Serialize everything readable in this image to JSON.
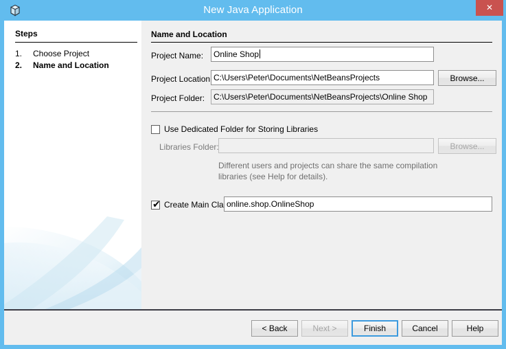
{
  "window": {
    "title": "New Java Application",
    "app_icon": "cube-icon",
    "close_label": "✕",
    "titlebar_color": "#62bcee",
    "close_button_color": "#c9524f",
    "content_bg": "#f0f0f0"
  },
  "sidebar": {
    "heading": "Steps",
    "steps": [
      {
        "number": "1.",
        "label": "Choose Project",
        "current": false
      },
      {
        "number": "2.",
        "label": "Name and Location",
        "current": true
      }
    ]
  },
  "main": {
    "heading": "Name and Location",
    "fields": {
      "project_name": {
        "label": "Project Name:",
        "value": "Online Shop",
        "placeholder": ""
      },
      "project_location": {
        "label": "Project Location:",
        "value": "C:\\Users\\Peter\\Documents\\NetBeansProjects",
        "placeholder": "",
        "browse_label": "Browse..."
      },
      "project_folder": {
        "label": "Project Folder:",
        "value": "C:\\Users\\Peter\\Documents\\NetBeansProjects\\Online Shop",
        "placeholder": ""
      },
      "dedicated_folder": {
        "label": "Use Dedicated Folder for Storing Libraries",
        "checked": false
      },
      "libraries_folder": {
        "label": "Libraries Folder:",
        "value": "",
        "placeholder": "",
        "browse_label": "Browse...",
        "disabled": true
      },
      "libraries_help_line1": "Different users and projects can share the same compilation",
      "libraries_help_line2": "libraries (see Help for details).",
      "create_main_class": {
        "label": "Create Main Class",
        "checked": true,
        "checkmark": "✔",
        "value": "online.shop.OnlineShop",
        "placeholder": ""
      }
    }
  },
  "footer": {
    "buttons": [
      {
        "label": "< Back",
        "disabled": false,
        "default": false
      },
      {
        "label": "Next >",
        "disabled": true,
        "default": false
      },
      {
        "label": "Finish",
        "disabled": false,
        "default": true
      },
      {
        "label": "Cancel",
        "disabled": false,
        "default": false
      },
      {
        "label": "Help",
        "disabled": false,
        "default": false
      }
    ]
  }
}
